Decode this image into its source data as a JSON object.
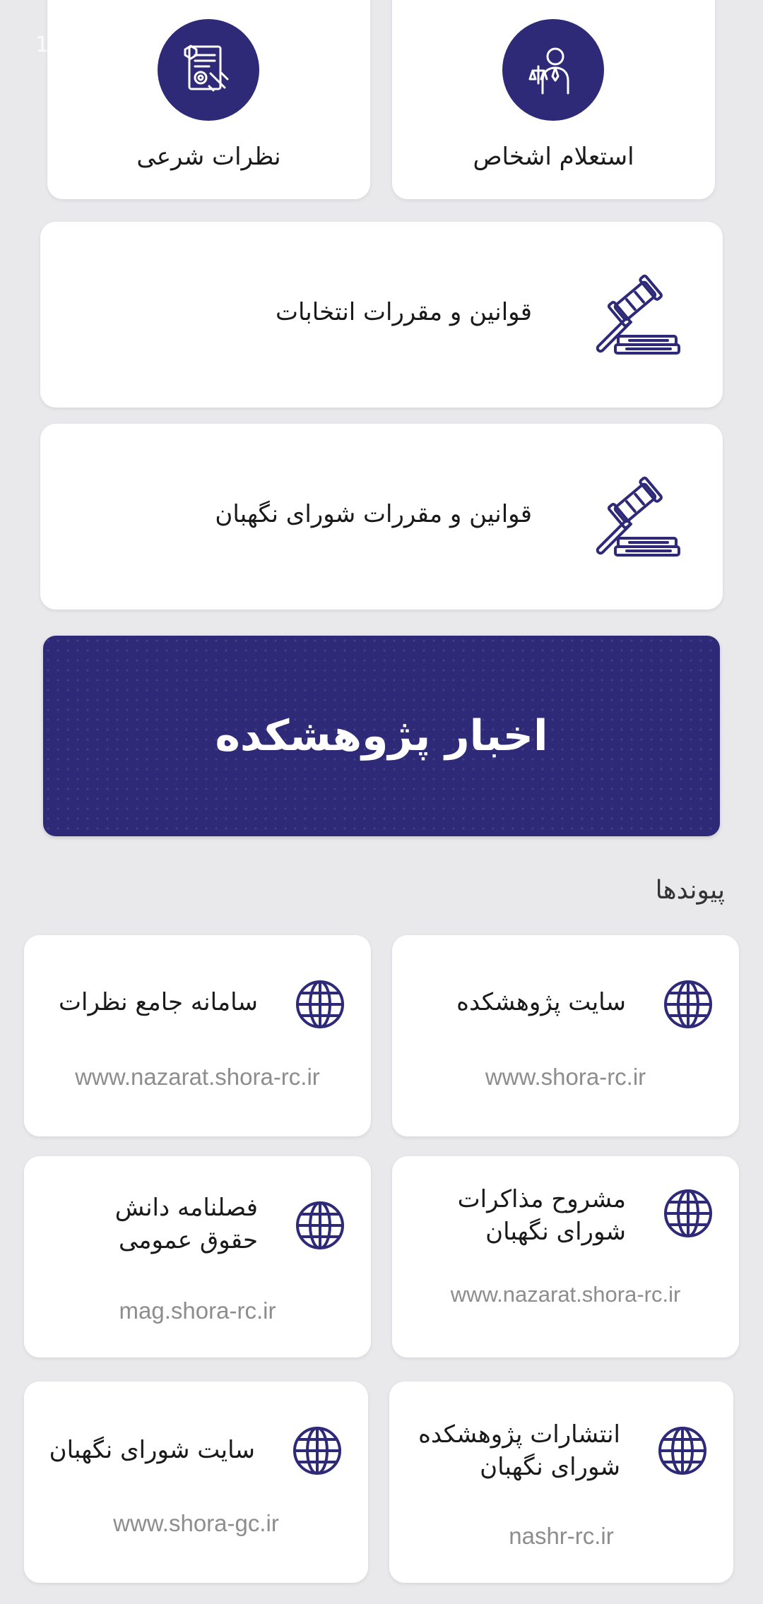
{
  "status_bar": {
    "time_fragment": "1"
  },
  "top_cards": {
    "left_label": "نظرات شرعی",
    "right_label": "استعلام اشخاص"
  },
  "rules_cards": {
    "elections_label": "قوانین و مقررات انتخابات",
    "council_label": "قوانین و مقررات شورای نگهبان"
  },
  "news_banner": {
    "label": "اخبار پژوهشکده"
  },
  "links": {
    "section_title": "پیوندها",
    "items": [
      {
        "title": "سایت پژوهشکده",
        "url": "www.shora-rc.ir"
      },
      {
        "title": "سامانه جامع نظرات",
        "url": "www.nazarat.shora-rc.ir"
      },
      {
        "title": "مشروح مذاکرات\nشورای نگهبان",
        "url": "www.nazarat.shora-rc.ir"
      },
      {
        "title": "فصلنامه دانش\nحقوق عمومی",
        "url": "mag.shora-rc.ir"
      },
      {
        "title": "انتشارات پژوهشکده\nشورای نگهبان",
        "url": "nashr-rc.ir"
      },
      {
        "title": "سایت شورای نگهبان",
        "url": "www.shora-gc.ir"
      }
    ]
  },
  "colors": {
    "accent": "#2e2a78",
    "background": "#e9e9ec",
    "card": "#ffffff",
    "url_text": "#8d8d8d"
  },
  "icons": {
    "top_left": "document-seal-icon",
    "top_right": "lawyer-icon",
    "rules": "gavel-icon",
    "links": "globe-icon"
  }
}
